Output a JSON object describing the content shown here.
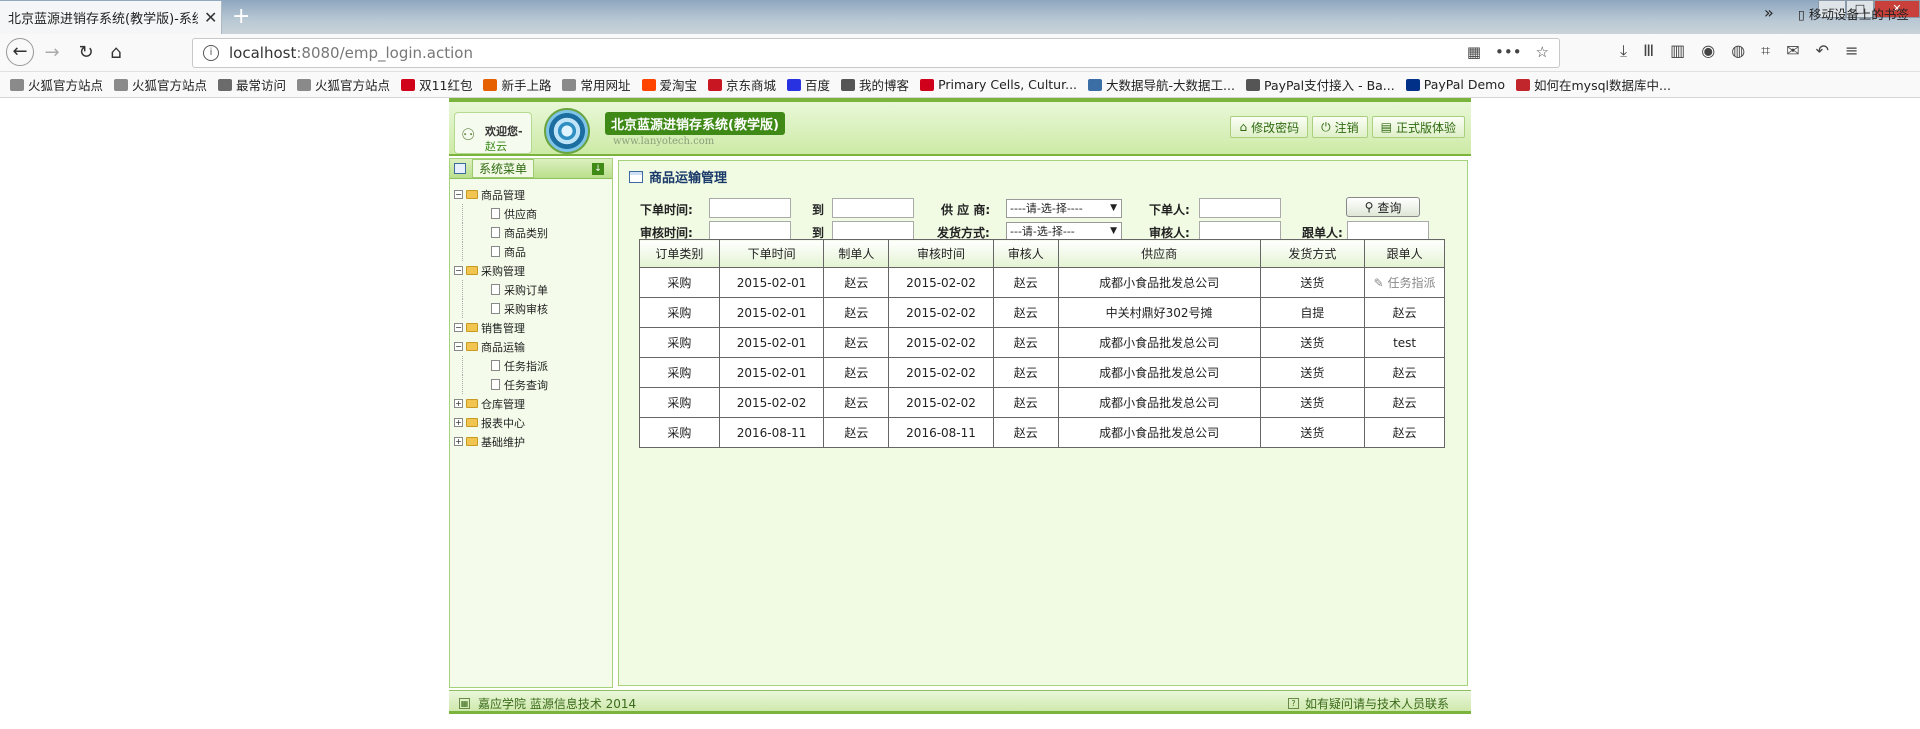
{
  "browser": {
    "tab_title": "北京蓝源进销存系统(教学版)-系统",
    "url_host": "localhost",
    "url_rest": ":8080/emp_login.action",
    "bookmarks": [
      {
        "label": "火狐官方站点",
        "color": "#8a8a8a"
      },
      {
        "label": "火狐官方站点",
        "color": "#8a8a8a"
      },
      {
        "label": "最常访问",
        "color": "#6b6b6b"
      },
      {
        "label": "火狐官方站点",
        "color": "#8a8a8a"
      },
      {
        "label": "双11红包",
        "color": "#d0021b"
      },
      {
        "label": "新手上路",
        "color": "#e66000"
      },
      {
        "label": "常用网址",
        "color": "#8a8a8a"
      },
      {
        "label": "爱淘宝",
        "color": "#ff4400"
      },
      {
        "label": "京东商城",
        "color": "#c91623"
      },
      {
        "label": "百度",
        "color": "#2932e1"
      },
      {
        "label": "我的博客",
        "color": "#555555"
      },
      {
        "label": "Primary Cells, Cultur...",
        "color": "#d0021b"
      },
      {
        "label": "大数据导航-大数据工...",
        "color": "#3a6ea5"
      },
      {
        "label": "PayPal支付接入 - Ba...",
        "color": "#555555"
      },
      {
        "label": "PayPal Demo",
        "color": "#003087"
      },
      {
        "label": "如何在mysql数据库中...",
        "color": "#c0262c"
      }
    ],
    "bookmarks_mobile": "移动设备上的书签"
  },
  "header": {
    "welcome_label": "欢迎您-",
    "welcome_user": "赵云",
    "system_title": "北京蓝源进销存系统(教学版)",
    "site": "www.lanyotech.com",
    "buttons": [
      "修改密码",
      "注销",
      "正式版体验"
    ]
  },
  "sidebar": {
    "title": "系统菜单",
    "tree": [
      {
        "label": "商品管理",
        "expanded": true,
        "children": [
          "供应商",
          "商品类别",
          "商品"
        ]
      },
      {
        "label": "采购管理",
        "expanded": true,
        "children": [
          "采购订单",
          "采购审核"
        ]
      },
      {
        "label": "销售管理",
        "expanded": true,
        "children": []
      },
      {
        "label": "商品运输",
        "expanded": true,
        "children": [
          "任务指派",
          "任务查询"
        ]
      },
      {
        "label": "仓库管理",
        "expanded": false,
        "children": []
      },
      {
        "label": "报表中心",
        "expanded": false,
        "children": []
      },
      {
        "label": "基础维护",
        "expanded": false,
        "children": []
      }
    ]
  },
  "main": {
    "title": "商品运输管理",
    "filters": {
      "order_time_label": "下单时间:",
      "to_label_1": "到",
      "supplier_label": "供 应 商:",
      "supplier_value": "----请-选-择----",
      "orderer_label": "下单人:",
      "audit_time_label": "审核时间:",
      "to_label_2": "到",
      "ship_label": "发货方式:",
      "ship_value": "---请-选-择---",
      "auditor_label": "审核人:",
      "follower_label": "跟单人:",
      "query_label": "查询"
    },
    "columns": [
      "订单类别",
      "下单时间",
      "制单人",
      "审核时间",
      "审核人",
      "供应商",
      "发货方式",
      "跟单人"
    ],
    "rows": [
      [
        "采购",
        "2015-02-01",
        "赵云",
        "2015-02-02",
        "赵云",
        "成都小食品批发总公司",
        "送货",
        "任务指派"
      ],
      [
        "采购",
        "2015-02-01",
        "赵云",
        "2015-02-02",
        "赵云",
        "中关村鼎好302号摊",
        "自提",
        "赵云"
      ],
      [
        "采购",
        "2015-02-01",
        "赵云",
        "2015-02-02",
        "赵云",
        "成都小食品批发总公司",
        "送货",
        "test"
      ],
      [
        "采购",
        "2015-02-01",
        "赵云",
        "2015-02-02",
        "赵云",
        "成都小食品批发总公司",
        "送货",
        "赵云"
      ],
      [
        "采购",
        "2015-02-02",
        "赵云",
        "2015-02-02",
        "赵云",
        "成都小食品批发总公司",
        "送货",
        "赵云"
      ],
      [
        "采购",
        "2016-08-11",
        "赵云",
        "2016-08-11",
        "赵云",
        "成都小食品批发总公司",
        "送货",
        "赵云"
      ]
    ]
  },
  "footer": {
    "left": "嘉应学院 蓝源信息技术 2014",
    "right": "如有疑问请与技术人员联系"
  }
}
